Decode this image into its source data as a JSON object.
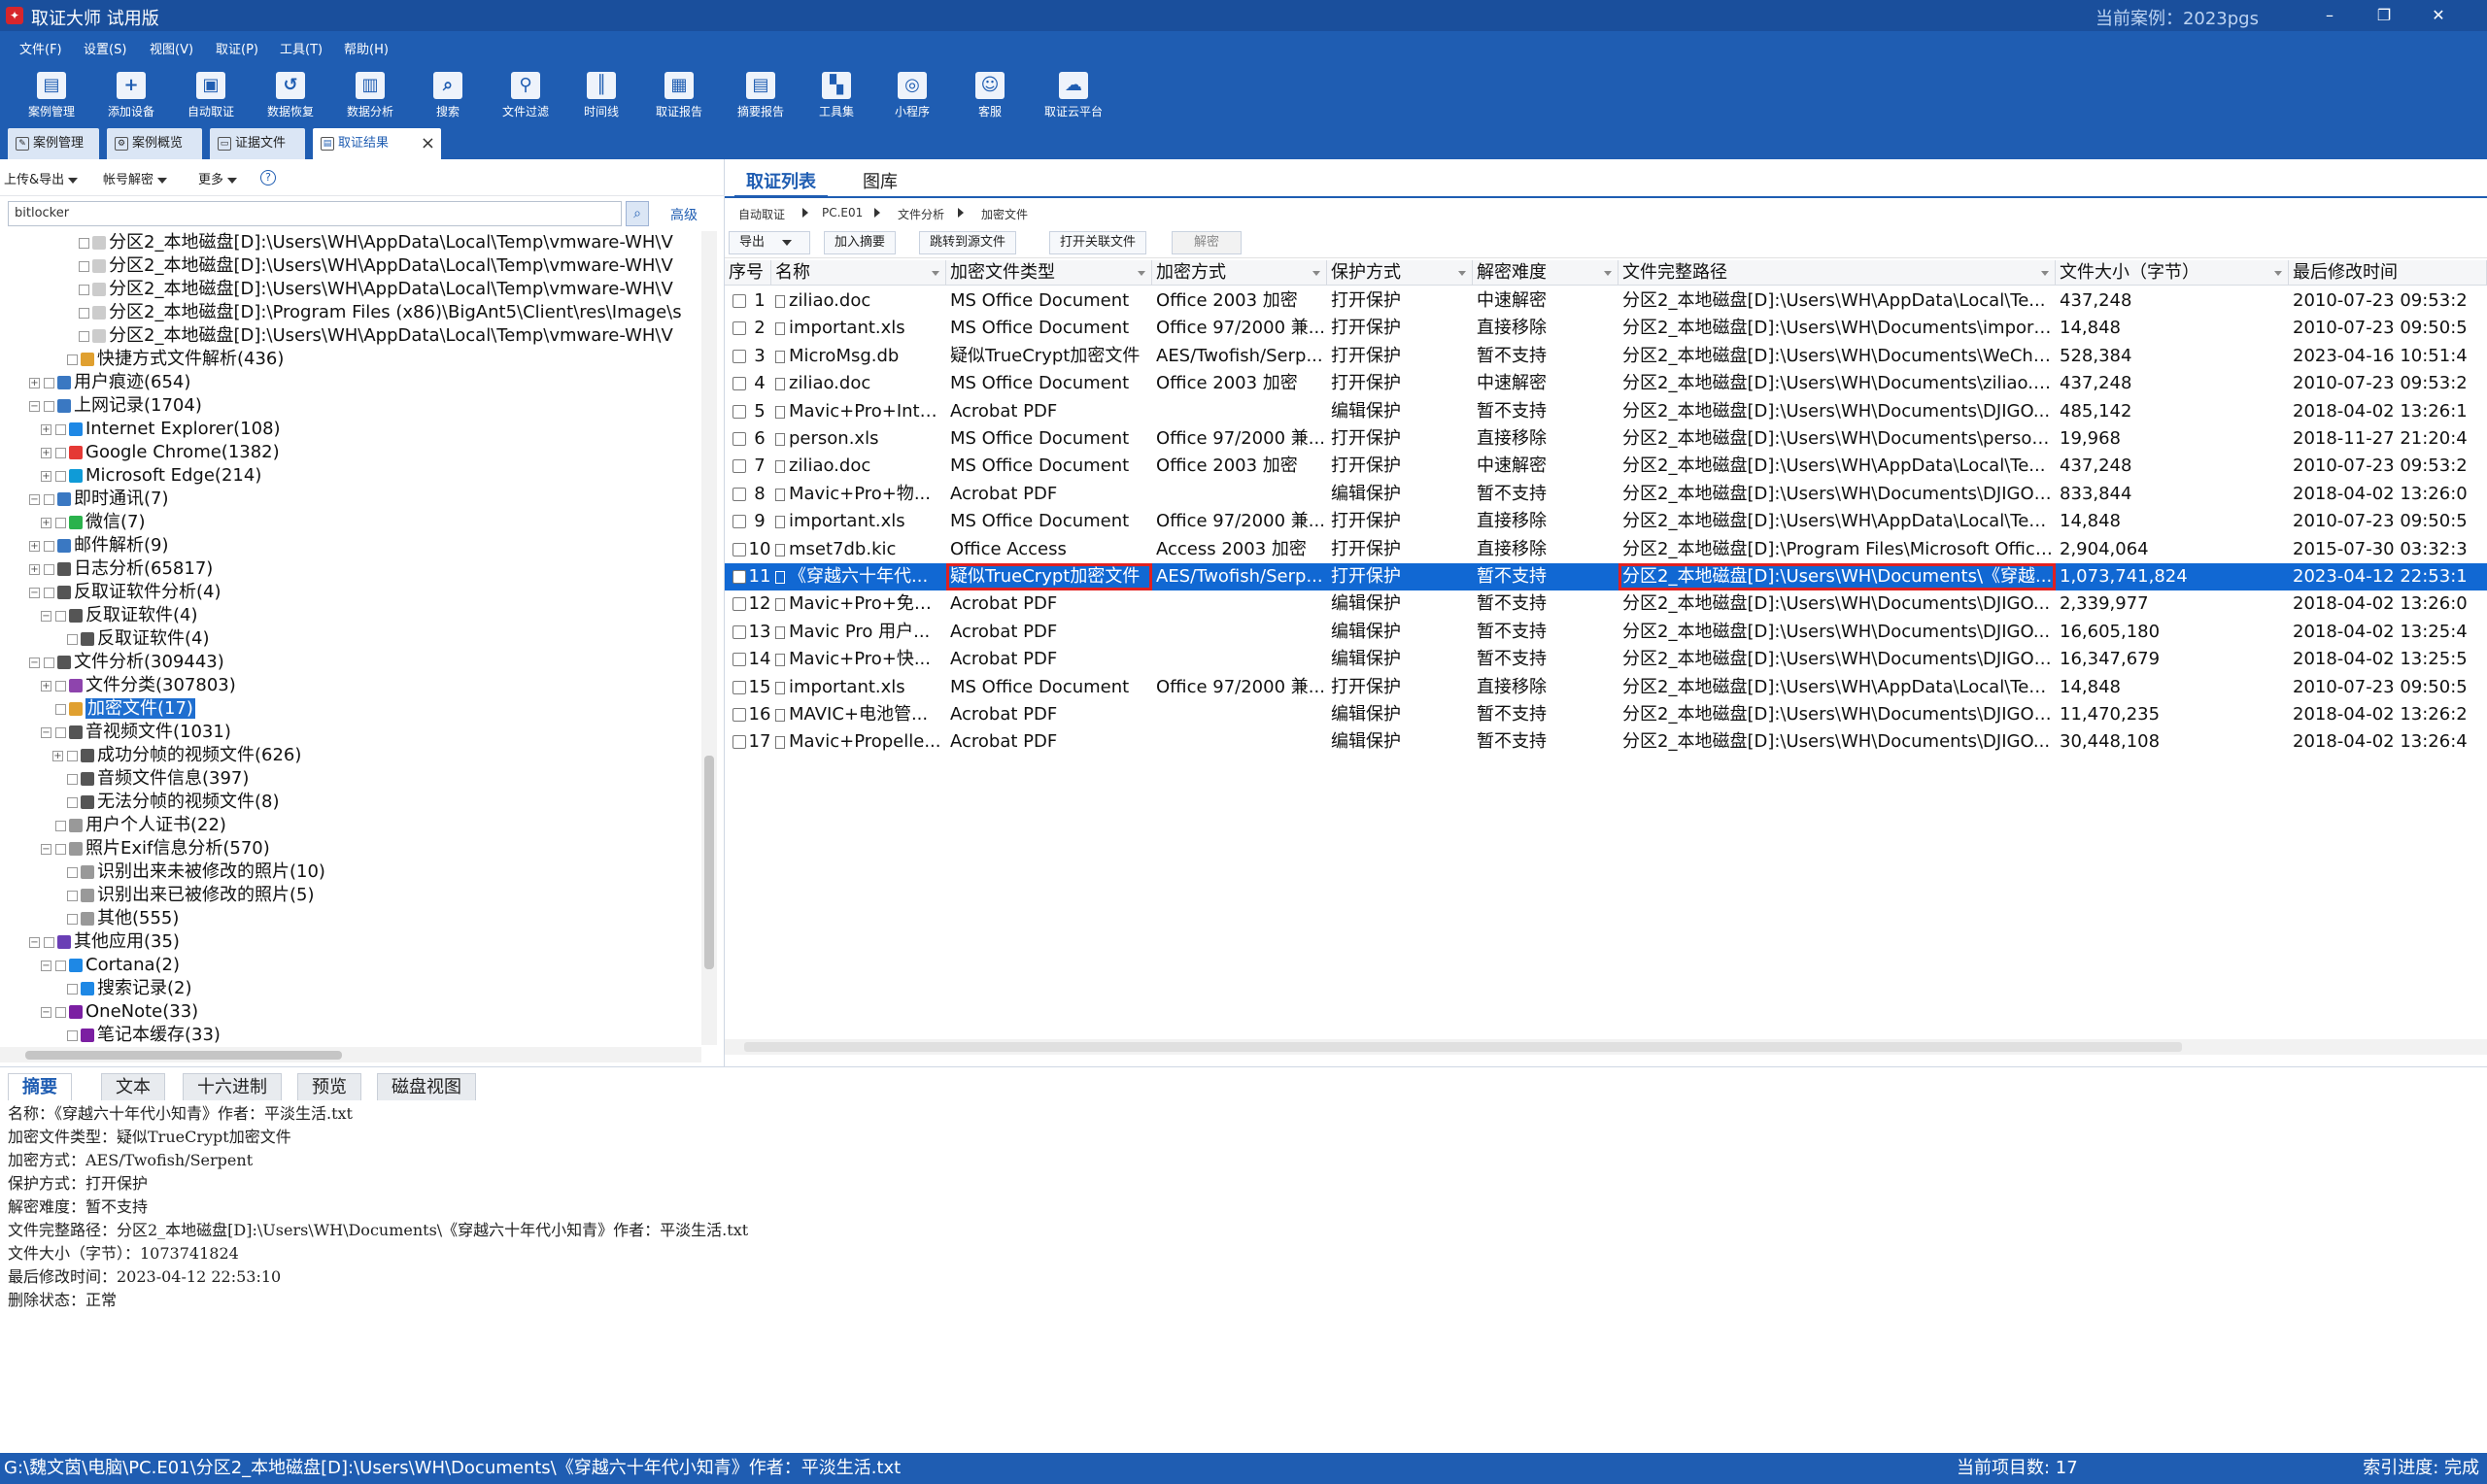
{
  "window": {
    "title": "取证大师 试用版",
    "current_case": "当前案例：2023pgs"
  },
  "menu": [
    "文件(F)",
    "设置(S)",
    "视图(V)",
    "取证(P)",
    "工具(T)",
    "帮助(H)"
  ],
  "toolbar": [
    {
      "label": "案例管理",
      "icon": "case-management-icon"
    },
    {
      "label": "添加设备",
      "icon": "add-device-icon"
    },
    {
      "label": "自动取证",
      "icon": "auto-forensics-icon"
    },
    {
      "label": "数据恢复",
      "icon": "data-recovery-icon"
    },
    {
      "label": "数据分析",
      "icon": "data-analysis-icon"
    },
    {
      "label": "搜索",
      "icon": "search-icon"
    },
    {
      "label": "文件过滤",
      "icon": "file-filter-icon"
    },
    {
      "label": "时间线",
      "icon": "timeline-icon"
    },
    {
      "label": "取证报告",
      "icon": "forensics-report-icon"
    },
    {
      "label": "摘要报告",
      "icon": "summary-report-icon"
    },
    {
      "label": "工具集",
      "icon": "toolset-icon"
    },
    {
      "label": "小程序",
      "icon": "miniprogram-icon"
    },
    {
      "label": "客服",
      "icon": "customer-service-icon"
    },
    {
      "label": "取证云平台",
      "icon": "cloud-platform-icon"
    }
  ],
  "doc_tabs": [
    "案例管理",
    "案例概览",
    "证据文件",
    "取证结果"
  ],
  "left": {
    "dropdowns": [
      "上传&导出",
      "帐号解密",
      "更多"
    ],
    "help": "?",
    "search_value": "bitlocker",
    "advanced": "高级",
    "tree": [
      {
        "text": "分区2_本地磁盘[D]:\\Users\\WH\\AppData\\Local\\Temp\\vmware-WH\\V",
        "level": 4,
        "expander": "",
        "color": "#cccccc"
      },
      {
        "text": "分区2_本地磁盘[D]:\\Users\\WH\\AppData\\Local\\Temp\\vmware-WH\\V",
        "level": 4,
        "expander": "",
        "color": "#cccccc"
      },
      {
        "text": "分区2_本地磁盘[D]:\\Users\\WH\\AppData\\Local\\Temp\\vmware-WH\\V",
        "level": 4,
        "expander": "",
        "color": "#cccccc"
      },
      {
        "text": "分区2_本地磁盘[D]:\\Program Files (x86)\\BigAnt5\\Client\\res\\Image\\s",
        "level": 4,
        "expander": "",
        "color": "#cccccc"
      },
      {
        "text": "分区2_本地磁盘[D]:\\Users\\WH\\AppData\\Local\\Temp\\vmware-WH\\V",
        "level": 4,
        "expander": "",
        "color": "#cccccc"
      },
      {
        "text": "快捷方式文件解析(436)",
        "level": 3,
        "expander": "",
        "color": "#e0a030"
      },
      {
        "text": "用户痕迹(654)",
        "level": 1,
        "expander": "+",
        "color": "#3a78c2"
      },
      {
        "text": "上网记录(1704)",
        "level": 1,
        "expander": "−",
        "color": "#3a78c2"
      },
      {
        "text": "Internet Explorer(108)",
        "level": 2,
        "expander": "+",
        "color": "#1e88e5"
      },
      {
        "text": "Google Chrome(1382)",
        "level": 2,
        "expander": "+",
        "color": "#e53935"
      },
      {
        "text": "Microsoft Edge(214)",
        "level": 2,
        "expander": "+",
        "color": "#0f9bd7"
      },
      {
        "text": "即时通讯(7)",
        "level": 1,
        "expander": "−",
        "color": "#3a78c2"
      },
      {
        "text": "微信(7)",
        "level": 2,
        "expander": "+",
        "color": "#2bb24c"
      },
      {
        "text": "邮件解析(9)",
        "level": 1,
        "expander": "+",
        "color": "#3a78c2"
      },
      {
        "text": "日志分析(65817)",
        "level": 1,
        "expander": "+",
        "color": "#555555"
      },
      {
        "text": "反取证软件分析(4)",
        "level": 1,
        "expander": "−",
        "color": "#555555"
      },
      {
        "text": "反取证软件(4)",
        "level": 2,
        "expander": "−",
        "color": "#555555"
      },
      {
        "text": "反取证软件(4)",
        "level": 3,
        "expander": "",
        "color": "#555555"
      },
      {
        "text": "文件分析(309443)",
        "level": 1,
        "expander": "−",
        "color": "#555555"
      },
      {
        "text": "文件分类(307803)",
        "level": 2,
        "expander": "+",
        "color": "#8e44ad"
      },
      {
        "text": "加密文件(17)",
        "level": 2,
        "expander": "",
        "color": "#e0a030",
        "selected": true
      },
      {
        "text": "音视频文件(1031)",
        "level": 2,
        "expander": "−",
        "color": "#555555"
      },
      {
        "text": "成功分帧的视频文件(626)",
        "level": 3,
        "expander": "+",
        "color": "#555555"
      },
      {
        "text": "音频文件信息(397)",
        "level": 3,
        "expander": "",
        "color": "#555555"
      },
      {
        "text": "无法分帧的视频文件(8)",
        "level": 3,
        "expander": "",
        "color": "#555555"
      },
      {
        "text": "用户个人证书(22)",
        "level": 2,
        "expander": "",
        "color": "#999999"
      },
      {
        "text": "照片Exif信息分析(570)",
        "level": 2,
        "expander": "−",
        "color": "#999999"
      },
      {
        "text": "识别出来未被修改的照片(10)",
        "level": 3,
        "expander": "",
        "color": "#999999"
      },
      {
        "text": "识别出来已被修改的照片(5)",
        "level": 3,
        "expander": "",
        "color": "#999999"
      },
      {
        "text": "其他(555)",
        "level": 3,
        "expander": "",
        "color": "#999999"
      },
      {
        "text": "其他应用(35)",
        "level": 1,
        "expander": "−",
        "color": "#6a3fb5"
      },
      {
        "text": "Cortana(2)",
        "level": 2,
        "expander": "−",
        "color": "#1e88e5"
      },
      {
        "text": "搜索记录(2)",
        "level": 3,
        "expander": "",
        "color": "#1e88e5"
      },
      {
        "text": "OneNote(33)",
        "level": 2,
        "expander": "−",
        "color": "#7b1fa2"
      },
      {
        "text": "笔记本缓存(33)",
        "level": 3,
        "expander": "",
        "color": "#7b1fa2"
      }
    ]
  },
  "right": {
    "tabs": [
      "取证列表",
      "图库"
    ],
    "breadcrumb": [
      "自动取证",
      "PC.E01",
      "文件分析",
      "加密文件"
    ],
    "actions": [
      "导出",
      "加入摘要",
      "跳转到源文件",
      "打开关联文件",
      "解密"
    ],
    "columns": [
      "序号",
      "名称",
      "加密文件类型",
      "加密方式",
      "保护方式",
      "解密难度",
      "文件完整路径",
      "文件大小（字节）",
      "最后修改时间"
    ],
    "rows": [
      [
        "1",
        "ziliao.doc",
        "MS Office Document",
        "Office 2003 加密",
        "打开保护",
        "中速解密",
        "分区2_本地磁盘[D]:\\Users\\WH\\AppData\\Local\\Te...",
        "437,248",
        "2010-07-23 09:53:2"
      ],
      [
        "2",
        "important.xls",
        "MS Office Document",
        "Office 97/2000 兼...",
        "打开保护",
        "直接移除",
        "分区2_本地磁盘[D]:\\Users\\WH\\Documents\\import...",
        "14,848",
        "2010-07-23 09:50:5"
      ],
      [
        "3",
        "MicroMsg.db",
        "疑似TrueCrypt加密文件",
        "AES/Twofish/Serp...",
        "打开保护",
        "暂不支持",
        "分区2_本地磁盘[D]:\\Users\\WH\\Documents\\WeCha...",
        "528,384",
        "2023-04-16 10:51:4"
      ],
      [
        "4",
        "ziliao.doc",
        "MS Office Document",
        "Office 2003 加密",
        "打开保护",
        "中速解密",
        "分区2_本地磁盘[D]:\\Users\\WH\\Documents\\ziliao.doc",
        "437,248",
        "2010-07-23 09:53:2"
      ],
      [
        "5",
        "Mavic+Pro+Inte...",
        "Acrobat PDF",
        "",
        "编辑保护",
        "暂不支持",
        "分区2_本地磁盘[D]:\\Users\\WH\\Documents\\DJIGO...",
        "485,142",
        "2018-04-02 13:26:1"
      ],
      [
        "6",
        "person.xls",
        "MS Office Document",
        "Office 97/2000 兼...",
        "打开保护",
        "直接移除",
        "分区2_本地磁盘[D]:\\Users\\WH\\Documents\\person...",
        "19,968",
        "2018-11-27 21:20:4"
      ],
      [
        "7",
        "ziliao.doc",
        "MS Office Document",
        "Office 2003 加密",
        "打开保护",
        "中速解密",
        "分区2_本地磁盘[D]:\\Users\\WH\\AppData\\Local\\Te...",
        "437,248",
        "2010-07-23 09:53:2"
      ],
      [
        "8",
        "Mavic+Pro+物...",
        "Acrobat PDF",
        "",
        "编辑保护",
        "暂不支持",
        "分区2_本地磁盘[D]:\\Users\\WH\\Documents\\DJIGO相...",
        "833,844",
        "2018-04-02 13:26:0"
      ],
      [
        "9",
        "important.xls",
        "MS Office Document",
        "Office 97/2000 兼...",
        "打开保护",
        "直接移除",
        "分区2_本地磁盘[D]:\\Users\\WH\\AppData\\Local\\Tem...",
        "14,848",
        "2010-07-23 09:50:5"
      ],
      [
        "10",
        "mset7db.kic",
        "Office Access",
        "Access 2003 加密",
        "打开保护",
        "直接移除",
        "分区2_本地磁盘[D]:\\Program Files\\Microsoft Office...",
        "2,904,064",
        "2015-07-30 03:32:3"
      ],
      [
        "11",
        "《穿越六十年代...",
        "疑似TrueCrypt加密文件",
        "AES/Twofish/Serp...",
        "打开保护",
        "暂不支持",
        "分区2_本地磁盘[D]:\\Users\\WH\\Documents\\《穿越...",
        "1,073,741,824",
        "2023-04-12 22:53:1"
      ],
      [
        "12",
        "Mavic+Pro+免责...",
        "Acrobat PDF",
        "",
        "编辑保护",
        "暂不支持",
        "分区2_本地磁盘[D]:\\Users\\WH\\Documents\\DJIGO...",
        "2,339,977",
        "2018-04-02 13:26:0"
      ],
      [
        "13",
        "Mavic Pro 用户...",
        "Acrobat PDF",
        "",
        "编辑保护",
        "暂不支持",
        "分区2_本地磁盘[D]:\\Users\\WH\\Documents\\DJIGO...",
        "16,605,180",
        "2018-04-02 13:25:4"
      ],
      [
        "14",
        "Mavic+Pro+快...",
        "Acrobat PDF",
        "",
        "编辑保护",
        "暂不支持",
        "分区2_本地磁盘[D]:\\Users\\WH\\Documents\\DJIGO相...",
        "16,347,679",
        "2018-04-02 13:25:5"
      ],
      [
        "15",
        "important.xls",
        "MS Office Document",
        "Office 97/2000 兼...",
        "打开保护",
        "直接移除",
        "分区2_本地磁盘[D]:\\Users\\WH\\AppData\\Local\\Tem...",
        "14,848",
        "2010-07-23 09:50:5"
      ],
      [
        "16",
        "MAVIC+电池管...",
        "Acrobat PDF",
        "",
        "编辑保护",
        "暂不支持",
        "分区2_本地磁盘[D]:\\Users\\WH\\Documents\\DJIGO相...",
        "11,470,235",
        "2018-04-02 13:26:2"
      ],
      [
        "17",
        "Mavic+Propelle...",
        "Acrobat PDF",
        "",
        "编辑保护",
        "暂不支持",
        "分区2_本地磁盘[D]:\\Users\\WH\\Documents\\DJIGO...",
        "30,448,108",
        "2018-04-02 13:26:4"
      ]
    ],
    "selected_row": "11"
  },
  "bottom": {
    "tabs": [
      "摘要",
      "文本",
      "十六进制",
      "预览",
      "磁盘视图"
    ],
    "lines": [
      "名称：《穿越六十年代小知青》作者：平淡生活.txt",
      "加密文件类型：疑似TrueCrypt加密文件",
      "加密方式：AES/Twofish/Serpent",
      "保护方式：打开保护",
      "解密难度：暂不支持",
      "文件完整路径：分区2_本地磁盘[D]:\\Users\\WH\\Documents\\《穿越六十年代小知青》作者：平淡生活.txt",
      "文件大小（字节）：1073741824",
      "最后修改时间：2023-04-12 22:53:10",
      "删除状态：正常"
    ]
  },
  "status": {
    "path": "G:\\魏文茵\\电脑\\PC.E01\\分区2_本地磁盘[D]:\\Users\\WH\\Documents\\《穿越六十年代小知青》作者：平淡生活.txt",
    "count": "当前项目数: 17",
    "index": "索引进度: 完成"
  },
  "colors": {
    "brand": "#1f5db2",
    "selection": "#1168d3",
    "highlight_box": "#e02020"
  }
}
